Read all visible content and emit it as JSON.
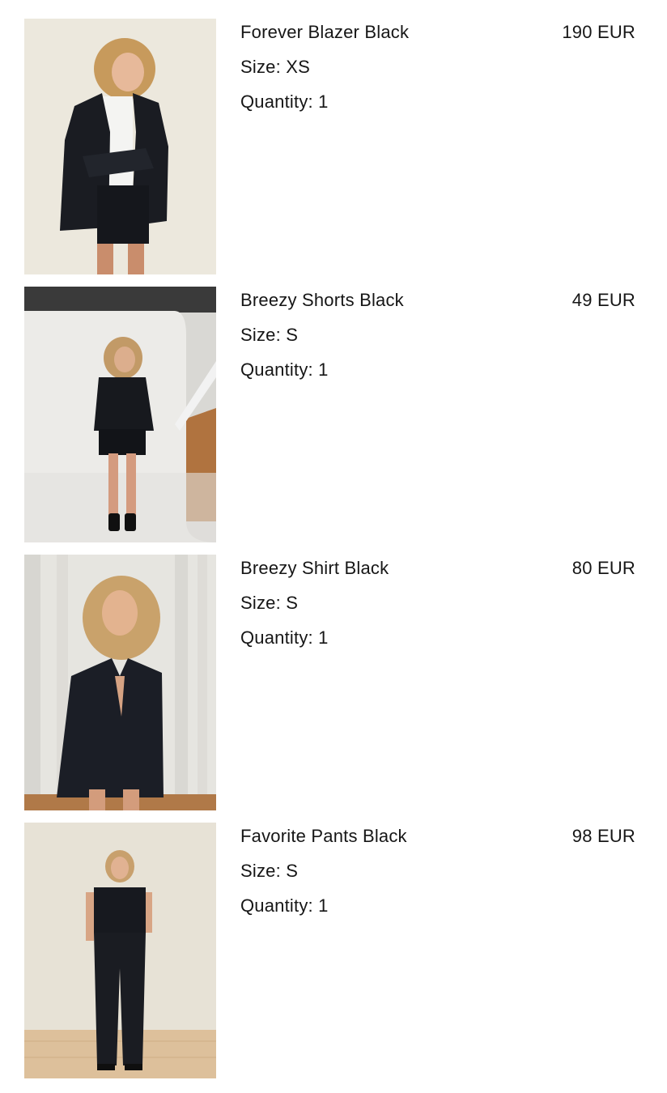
{
  "cart": {
    "items": [
      {
        "name": "Forever Blazer Black",
        "price": "190 EUR",
        "size_label": "Size:",
        "size": "XS",
        "quantity_label": "Quantity:",
        "quantity": "1",
        "photo_icon": "product-photo-blazer"
      },
      {
        "name": "Breezy Shorts Black",
        "price": "49 EUR",
        "size_label": "Size:",
        "size": "S",
        "quantity_label": "Quantity:",
        "quantity": "1",
        "photo_icon": "product-photo-shorts"
      },
      {
        "name": "Breezy Shirt Black",
        "price": "80 EUR",
        "size_label": "Size:",
        "size": "S",
        "quantity_label": "Quantity:",
        "quantity": "1",
        "photo_icon": "product-photo-shirt"
      },
      {
        "name": "Favorite Pants Black",
        "price": "98 EUR",
        "size_label": "Size:",
        "size": "S",
        "quantity_label": "Quantity:",
        "quantity": "1",
        "photo_icon": "product-photo-pants"
      }
    ]
  }
}
